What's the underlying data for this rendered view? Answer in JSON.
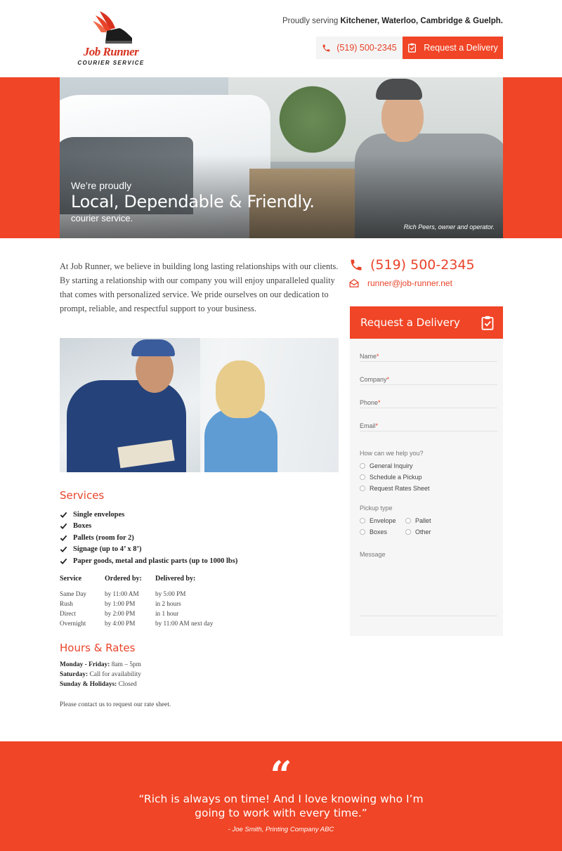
{
  "brand": {
    "name": "Job Runner",
    "tagline": "COURIER SERVICE"
  },
  "header": {
    "serving_prefix": "Proudly serving ",
    "serving_cities": "Kitchener, Waterloo, Cambridge & Guelph.",
    "phone": "(519) 500-2345",
    "request_button": "Request a Delivery"
  },
  "hero": {
    "pre": "We’re proudly",
    "title": "Local, Dependable & Friendly.",
    "post": "courier service.",
    "caption": "Rich Peers, owner and operator."
  },
  "intro": "At Job Runner, we believe in building long lasting relationships with our clients. By starting a relationship with our company you will enjoy unparalleled quality that comes with personalized service. We pride ourselves on our dedication to prompt, reliable, and respectful support to your business.",
  "services": {
    "title": "Services",
    "items": [
      "Single envelopes",
      "Boxes",
      "Pallets (room for 2)",
      "Signage (up to 4’ x 8’)",
      "Paper goods, metal and plastic parts (up to 1000 lbs)"
    ],
    "table": {
      "headers": [
        "Service",
        "Ordered by:",
        "Delivered by:"
      ],
      "rows": [
        [
          "Same Day",
          "by 11:00 AM",
          "by 5:00 PM"
        ],
        [
          "Rush",
          "by 1:00 PM",
          "in 2 hours"
        ],
        [
          "Direct",
          "by 2:00 PM",
          "in 1 hour"
        ],
        [
          "Overnight",
          "by 4:00 PM",
          "by 11:00 AM next day"
        ]
      ]
    }
  },
  "hours": {
    "title": "Hours & Rates",
    "rows": [
      {
        "label": "Monday - Friday:",
        "value": "8am – 5pm"
      },
      {
        "label": "Saturday:",
        "value": "Call for availability"
      },
      {
        "label": "Sunday & Holidays:",
        "value": "Closed"
      }
    ],
    "note": "Please contact us to request our rate sheet."
  },
  "sidebar": {
    "phone": "(519) 500-2345",
    "email": "runner@job-runner.net"
  },
  "form": {
    "title": "Request a Delivery",
    "fields": [
      "Name",
      "Company",
      "Phone",
      "Email"
    ],
    "help_label": "How can we help you?",
    "help_options": [
      "General Inquiry",
      "Schedule a Pickup",
      "Request Rates Sheet"
    ],
    "pickup_label": "Pickup type",
    "pickup_options": [
      "Envelope",
      "Pallet",
      "Boxes",
      "Other"
    ],
    "message_label": "Message"
  },
  "testimonial": {
    "quote": "“Rich is always on time! And I love knowing who I’m going to work with every time.”",
    "author": "- Joe Smith, Printing Company ABC"
  },
  "colors": {
    "accent": "#f04526",
    "accent_text": "#e8432a",
    "form_bg": "#f6f6f6"
  }
}
